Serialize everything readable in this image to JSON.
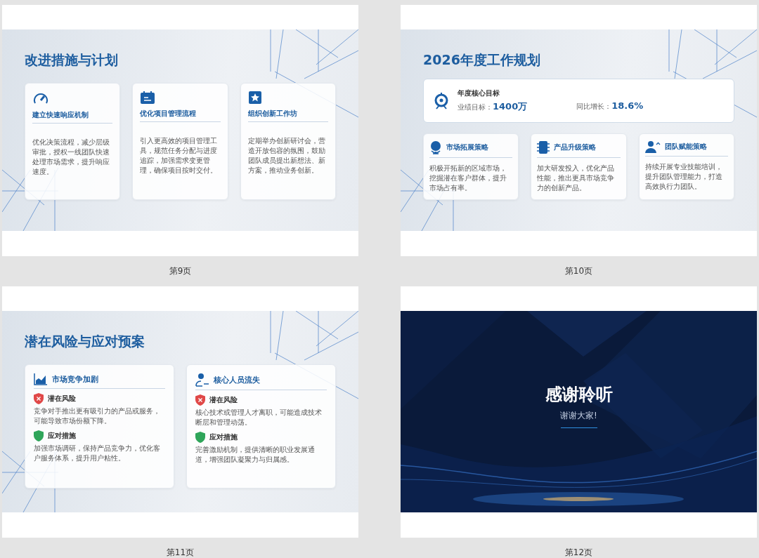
{
  "slides": [
    {
      "kind": "cards",
      "title": "改进措施与计划",
      "label": "第9页",
      "cards": [
        {
          "heading": "建立快速响应机制",
          "text": "优化决策流程，减少层级审批，授权一线团队快速处理市场需求，提升响应速度。"
        },
        {
          "heading": "优化项目管理流程",
          "text": "引入更高效的项目管理工具，规范任务分配与进度追踪，加强需求变更管理，确保项目按时交付。"
        },
        {
          "heading": "组织创新工作坊",
          "text": "定期举办创新研讨会，营造开放包容的氛围，鼓励团队成员提出新想法、新方案，推动业务创新。"
        }
      ]
    },
    {
      "kind": "goals",
      "title": "2026年度工作规划",
      "label": "第10页",
      "goal": {
        "heading": "年度核心目标",
        "metrics": [
          {
            "label": "业绩目标：",
            "value": "1400万"
          },
          {
            "label": "同比增长：",
            "value": "18.6%"
          }
        ]
      },
      "cards": [
        {
          "heading": "市场拓展策略",
          "text": "积极开拓新的区域市场，挖掘潜在客户群体，提升市场占有率。"
        },
        {
          "heading": "产品升级策略",
          "text": "加大研发投入，优化产品性能，推出更具市场竞争力的创新产品。"
        },
        {
          "heading": "团队赋能策略",
          "text": "持续开展专业技能培训，提升团队管理能力，打造高效执行力团队。"
        }
      ]
    },
    {
      "kind": "risks",
      "title": "潜在风险与应对预案",
      "label": "第11页",
      "cards": [
        {
          "heading": "市场竞争加剧",
          "items": [
            {
              "kind": "risk",
              "label": "潜在风险",
              "text": "竞争对手推出更有吸引力的产品或服务，可能导致市场份额下降。"
            },
            {
              "kind": "response",
              "label": "应对措施",
              "text": "加强市场调研，保持产品竞争力，优化客户服务体系，提升用户粘性。"
            }
          ]
        },
        {
          "heading": "核心人员流失",
          "items": [
            {
              "kind": "risk",
              "label": "潜在风险",
              "text": "核心技术或管理人才离职，可能造成技术断层和管理动荡。"
            },
            {
              "kind": "response",
              "label": "应对措施",
              "text": "完善激励机制，提供清晰的职业发展通道，增强团队凝聚力与归属感。"
            }
          ]
        }
      ]
    },
    {
      "kind": "closing",
      "title": "感谢聆听",
      "subtitle": "谢谢大家!",
      "label": "第12页"
    }
  ]
}
